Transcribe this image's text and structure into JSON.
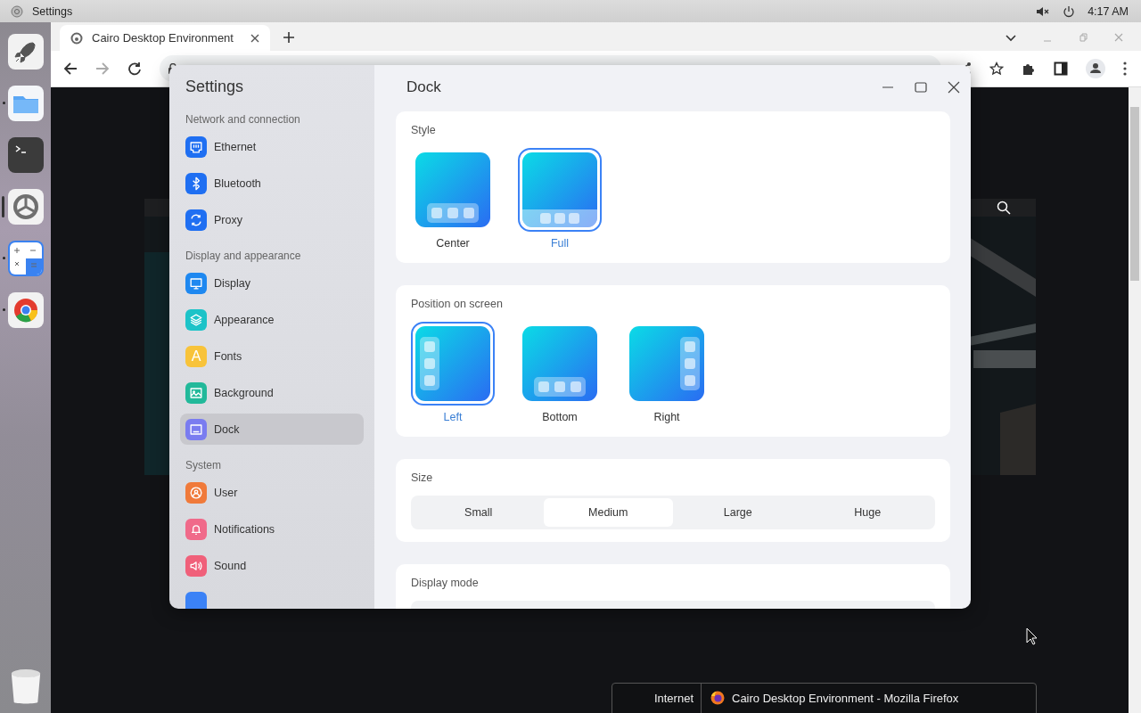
{
  "top_bar": {
    "title": "Settings",
    "time": "4:17 AM"
  },
  "dock": {
    "apps": [
      {
        "running": false,
        "focused": false
      },
      {
        "running": true,
        "focused": false
      },
      {
        "running": false,
        "focused": false
      },
      {
        "running": false,
        "focused": true
      },
      {
        "running": true,
        "focused": false
      },
      {
        "running": true,
        "focused": false
      }
    ]
  },
  "browser": {
    "tab": {
      "title": "Cairo Desktop Environment"
    }
  },
  "settings": {
    "title": "Settings",
    "page_title": "Dock",
    "groups": [
      {
        "label": "Network and connection",
        "items": [
          {
            "label": "Ethernet",
            "color": "#1f6ff2",
            "selected": false
          },
          {
            "label": "Bluetooth",
            "color": "#1f6ff2",
            "selected": false
          },
          {
            "label": "Proxy",
            "color": "#1f6ff2",
            "selected": false
          }
        ]
      },
      {
        "label": "Display and appearance",
        "items": [
          {
            "label": "Display",
            "color": "#1e88f0",
            "selected": false
          },
          {
            "label": "Appearance",
            "color": "#1cc3c8",
            "selected": false
          },
          {
            "label": "Fonts",
            "color": "#f8c33a",
            "selected": false,
            "icon_text": "A"
          },
          {
            "label": "Background",
            "color": "#22b99a",
            "selected": false
          },
          {
            "label": "Dock",
            "color": "#7a7cf0",
            "selected": true
          }
        ]
      },
      {
        "label": "System",
        "items": [
          {
            "label": "User",
            "color": "#f07a3a",
            "selected": false
          },
          {
            "label": "Notifications",
            "color": "#f06a8a",
            "selected": false
          },
          {
            "label": "Sound",
            "color": "#f0607a",
            "selected": false
          },
          {
            "color": "#3b82f6",
            "selected": false
          }
        ]
      }
    ],
    "sections": [
      {
        "kind": "tiles",
        "title": "Style",
        "options": [
          {
            "label": "Center",
            "kind": "center",
            "selected": false
          },
          {
            "label": "Full",
            "kind": "full",
            "selected": true
          }
        ]
      },
      {
        "kind": "tiles",
        "title": "Position on screen",
        "options": [
          {
            "label": "Left",
            "kind": "left",
            "selected": true
          },
          {
            "label": "Bottom",
            "kind": "bottom",
            "selected": false
          },
          {
            "label": "Right",
            "kind": "right",
            "selected": false
          }
        ]
      },
      {
        "kind": "segments",
        "title": "Size",
        "options": [
          {
            "label": "Small",
            "selected": false
          },
          {
            "label": "Medium",
            "selected": true
          },
          {
            "label": "Large",
            "selected": false
          },
          {
            "label": "Huge",
            "selected": false
          }
        ]
      },
      {
        "kind": "partial",
        "title": "Display mode"
      }
    ]
  },
  "taskbar_popup": {
    "category": "Internet",
    "window_title": "Cairo Desktop Environment - Mozilla Firefox"
  }
}
